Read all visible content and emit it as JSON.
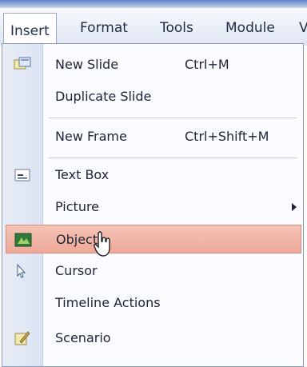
{
  "menubar": {
    "items": [
      {
        "label": "Insert",
        "active": true
      },
      {
        "label": "Format"
      },
      {
        "label": "Tools"
      },
      {
        "label": "Module"
      },
      {
        "label": "V"
      }
    ]
  },
  "dropdown": {
    "items": [
      {
        "label": "New Slide",
        "shortcut": "Ctrl+M",
        "icon": "new-slide-icon"
      },
      {
        "label": "Duplicate Slide"
      },
      {
        "label": "New Frame",
        "shortcut": "Ctrl+Shift+M"
      },
      {
        "label": "Text Box",
        "icon": "text-box-icon"
      },
      {
        "label": "Picture",
        "submenu": true
      },
      {
        "label": "Object...",
        "icon": "object-icon",
        "highlighted": true
      },
      {
        "label": "Cursor",
        "icon": "cursor-icon"
      },
      {
        "label": "Timeline Actions"
      },
      {
        "label": "Scenario",
        "icon": "scenario-icon"
      }
    ]
  },
  "colors": {
    "hover_bg": "#f0b0a2",
    "gutter": "#e2e8f4",
    "menubar": "#e9eef7"
  }
}
